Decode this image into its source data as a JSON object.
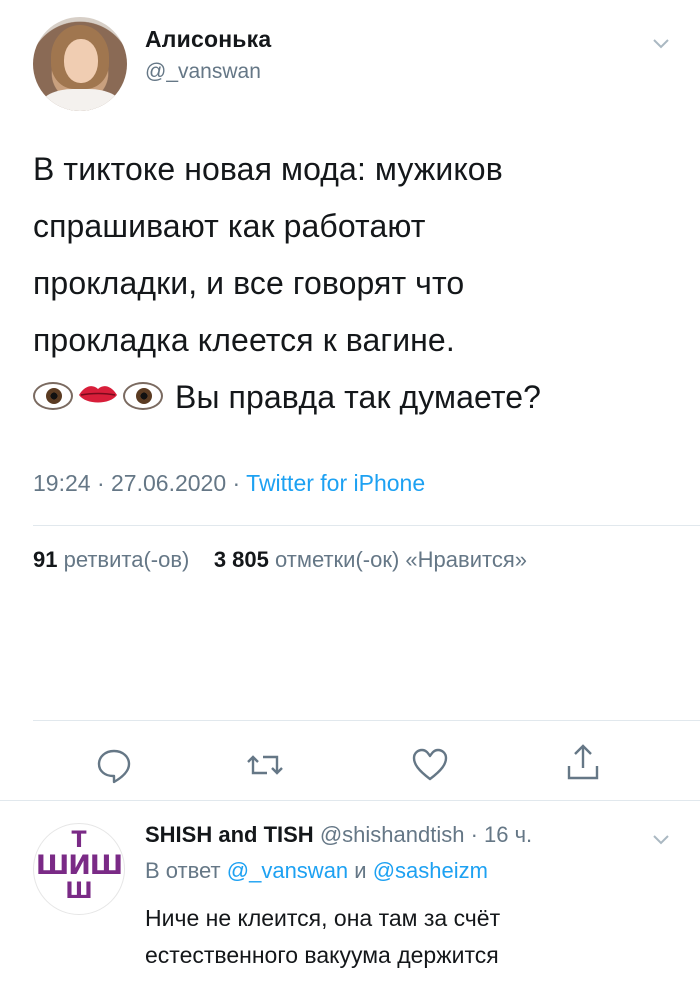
{
  "tweet": {
    "author_name": "Алисонька",
    "author_handle": "@_vanswan",
    "text_lines": [
      "В тиктоке новая мода: мужиков",
      "спрашивают как работают",
      "прокладки, и все говорят что",
      "прокладка клеется к вагине."
    ],
    "text_last": "Вы правда так думаете?",
    "emojis": [
      "eye-emoji",
      "lips-emoji",
      "eye-emoji"
    ],
    "time": "19:24",
    "date": "27.06.2020",
    "source": "Twitter for iPhone",
    "retweets_count": "91",
    "retweets_label": "ретвита(-ов)",
    "likes_count": "3 805",
    "likes_label": "отметки(-ок) «Нравится»"
  },
  "actions": [
    "reply-icon",
    "retweet-icon",
    "like-icon",
    "share-icon"
  ],
  "reply": {
    "author_name": "SHISH and TISH",
    "author_handle": "@shishandtish",
    "age": "16 ч.",
    "in_reply_to_prefix": "В ответ",
    "mention_1": "@_vanswan",
    "conjunction": "и",
    "mention_2": "@sasheizm",
    "text_lines": [
      "Ниче не клеится, она там за счёт",
      "естественного вакуума держится"
    ],
    "avatar_logo_top": "Т",
    "avatar_logo_mid": "ШИШ",
    "avatar_logo_bottom": "Ш"
  },
  "colors": {
    "text": "#14171a",
    "secondary": "#657786",
    "link": "#1da1f2",
    "divider": "#e1e8ed",
    "logo": "#7a2a86"
  }
}
